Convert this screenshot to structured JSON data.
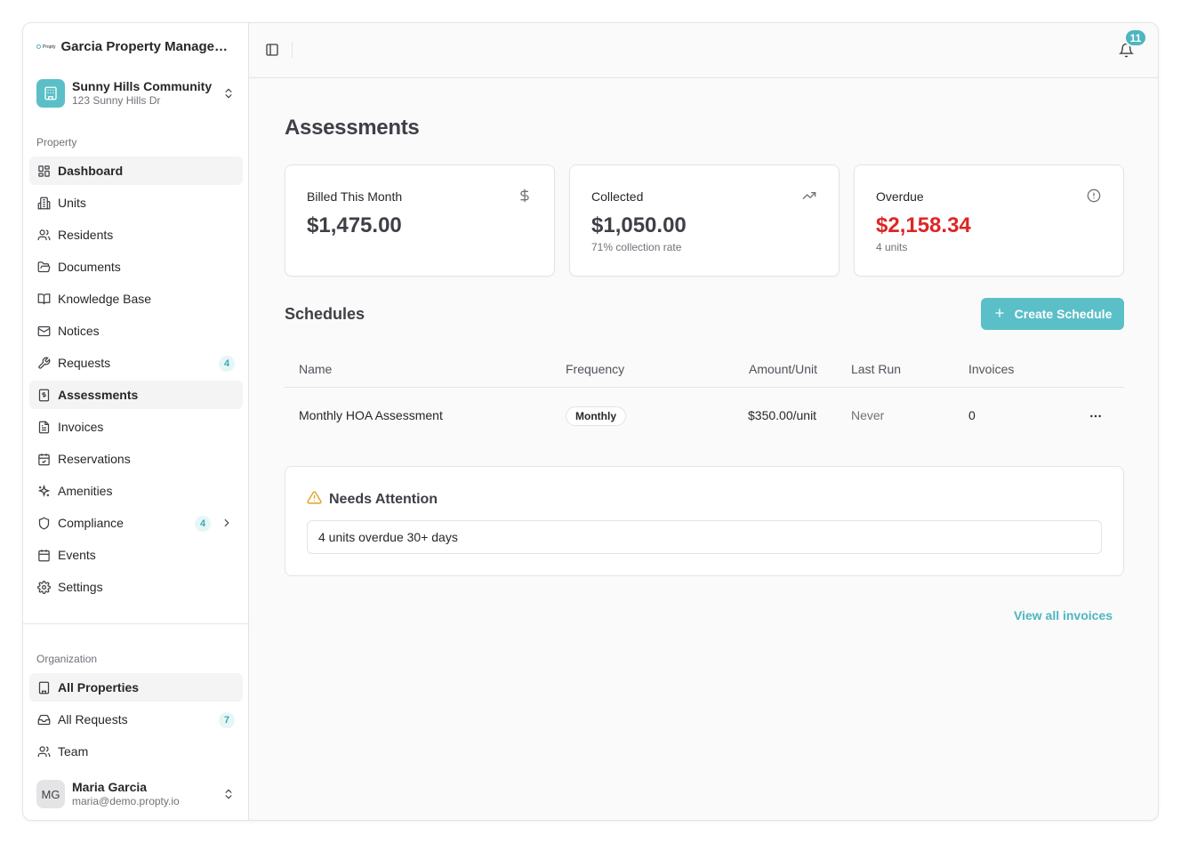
{
  "brand": {
    "logo_text": "Propty",
    "org_name": "Garcia Property Managem..."
  },
  "property": {
    "name": "Sunny Hills Community",
    "address": "123 Sunny Hills Dr"
  },
  "sections": {
    "property": "Property",
    "organization": "Organization"
  },
  "nav": [
    {
      "label": "Dashboard",
      "icon": "dashboard-icon"
    },
    {
      "label": "Units",
      "icon": "building-icon"
    },
    {
      "label": "Residents",
      "icon": "users-icon"
    },
    {
      "label": "Documents",
      "icon": "folder-icon"
    },
    {
      "label": "Knowledge Base",
      "icon": "book-icon"
    },
    {
      "label": "Notices",
      "icon": "mail-icon"
    },
    {
      "label": "Requests",
      "icon": "wrench-icon",
      "badge": "4"
    },
    {
      "label": "Assessments",
      "icon": "dollar-doc-icon",
      "active": true
    },
    {
      "label": "Invoices",
      "icon": "file-icon"
    },
    {
      "label": "Reservations",
      "icon": "calendar-check-icon"
    },
    {
      "label": "Amenities",
      "icon": "sparkles-icon"
    },
    {
      "label": "Compliance",
      "icon": "shield-icon",
      "badge": "4"
    },
    {
      "label": "Events",
      "icon": "calendar-icon"
    },
    {
      "label": "Settings",
      "icon": "gear-icon"
    }
  ],
  "org_nav": [
    {
      "label": "All Properties",
      "icon": "office-icon"
    },
    {
      "label": "All Requests",
      "icon": "inbox-icon",
      "badge": "7"
    },
    {
      "label": "Team",
      "icon": "users-icon"
    }
  ],
  "user": {
    "initials": "MG",
    "name": "Maria Garcia",
    "email": "maria@demo.propty.io"
  },
  "topbar": {
    "notifications": "11"
  },
  "page": {
    "title": "Assessments"
  },
  "stats": [
    {
      "label": "Billed This Month",
      "value": "$1,475.00",
      "sub": "",
      "icon": "dollar-icon"
    },
    {
      "label": "Collected",
      "value": "$1,050.00",
      "sub": "71% collection rate",
      "icon": "trending-up-icon"
    },
    {
      "label": "Overdue",
      "value": "$2,158.34",
      "sub": "4 units",
      "icon": "alert-circle-icon"
    }
  ],
  "schedules": {
    "title": "Schedules",
    "create_label": "Create Schedule",
    "columns": [
      "Name",
      "Frequency",
      "Amount/Unit",
      "Last Run",
      "Invoices"
    ],
    "rows": [
      {
        "name": "Monthly HOA Assessment",
        "frequency": "Monthly",
        "amount": "$350.00/unit",
        "last_run": "Never",
        "invoices": "0"
      }
    ]
  },
  "attention": {
    "title": "Needs Attention",
    "items": [
      "4 units overdue 30+ days"
    ]
  },
  "links": {
    "view_all": "View all invoices"
  },
  "colors": {
    "accent": "#5bbfc8",
    "overdue": "#dc2626",
    "warning": "#e0a125"
  }
}
